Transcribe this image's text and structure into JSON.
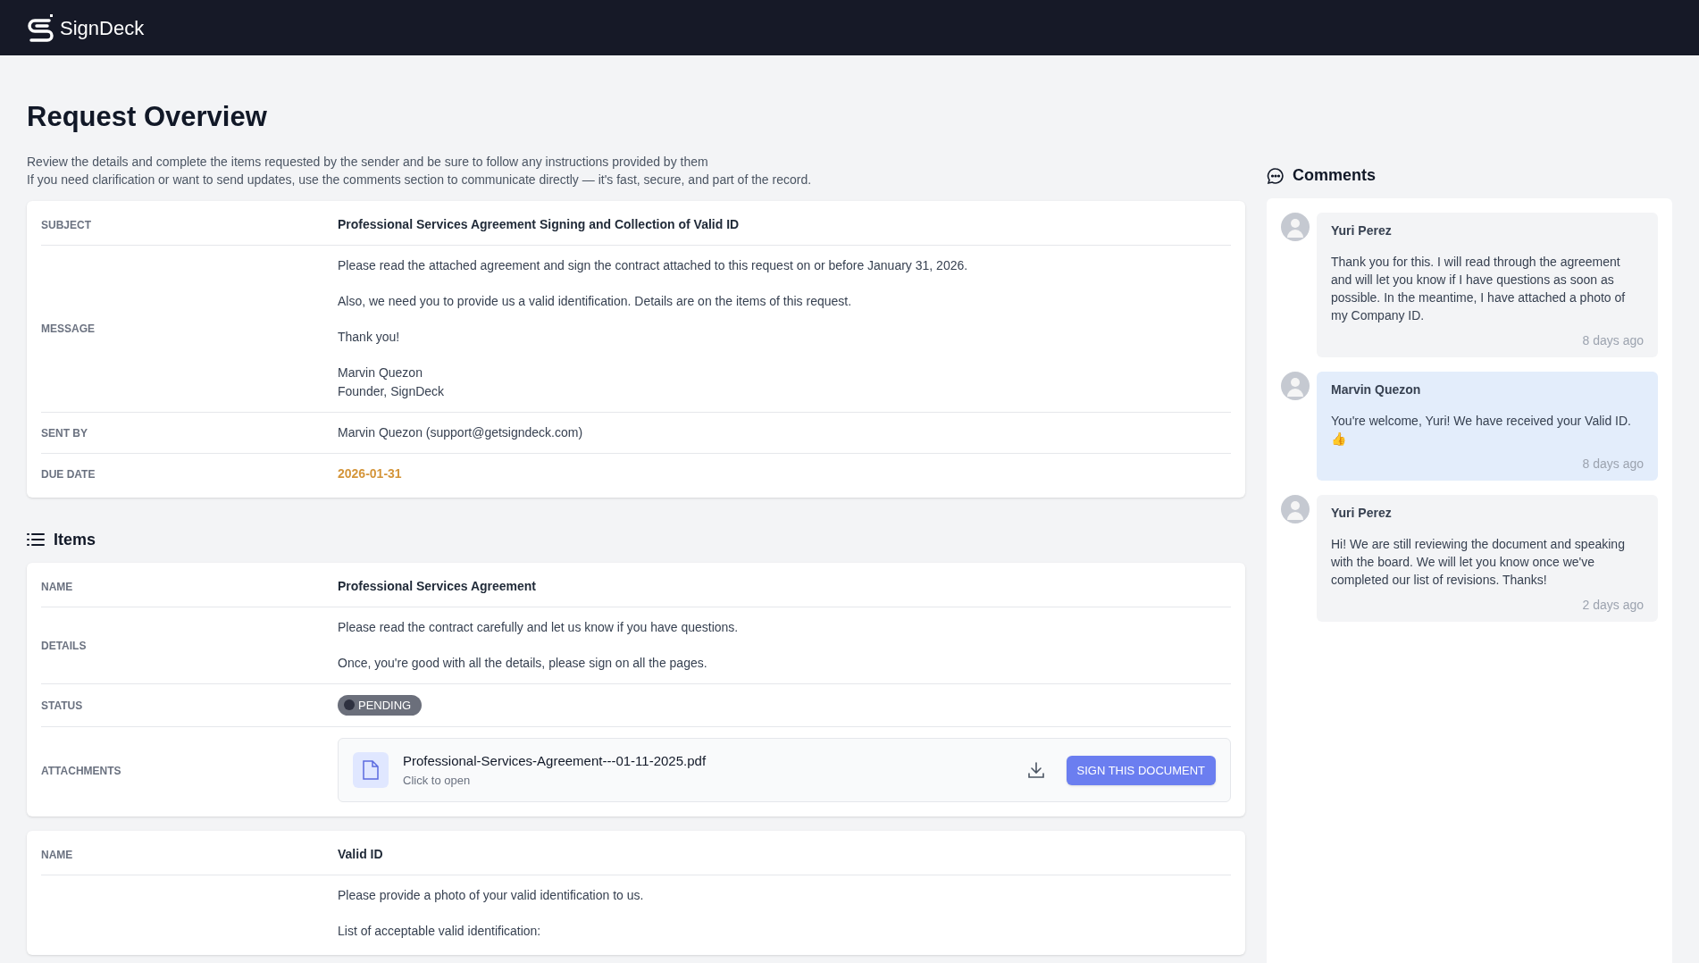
{
  "header": {
    "brand": "SignDeck"
  },
  "page": {
    "title": "Request Overview",
    "intro": [
      "Review the details and complete the items requested by the sender and be sure to follow any instructions provided by them",
      "If you need clarification or want to send updates, use the comments section to communicate directly — it's fast, secure, and part of the record."
    ]
  },
  "request": [
    {
      "label": "SUBJECT",
      "kind": "title",
      "value": [
        "Professional Services Agreement Signing and Collection of Valid ID"
      ]
    },
    {
      "label": "MESSAGE",
      "kind": "text",
      "value": [
        "Please read the attached agreement and sign the contract attached to this request on or before January 31, 2026.",
        "Also, we need you to provide us a valid identification. Details are on the items of this request.",
        "Thank you!",
        "Marvin Quezon\nFounder, SignDeck"
      ]
    },
    {
      "label": "SENT BY",
      "kind": "text",
      "value": [
        "Marvin Quezon (support@getsigndeck.com)"
      ]
    },
    {
      "label": "DUE DATE",
      "kind": "date",
      "value": [
        "2026-01-31"
      ]
    }
  ],
  "items_heading": "Items",
  "items": [
    {
      "rows": [
        {
          "label": "NAME",
          "kind": "title",
          "value": [
            "Professional Services Agreement"
          ]
        },
        {
          "label": "DETAILS",
          "kind": "text",
          "value": [
            "Please read the contract carefully and let us know if you have questions.",
            "Once, you're good with all the details, please sign on all the pages."
          ]
        },
        {
          "label": "STATUS",
          "kind": "status",
          "value": [
            "PENDING"
          ]
        },
        {
          "label": "ATTACHMENTS",
          "kind": "attachment",
          "file": "Professional-Services-Agreement---01-11-2025.pdf",
          "hint": "Click to open",
          "action": "SIGN THIS DOCUMENT"
        }
      ]
    },
    {
      "rows": [
        {
          "label": "NAME",
          "kind": "title",
          "value": [
            "Valid ID"
          ]
        },
        {
          "kind": "text",
          "value": [
            "Please provide a photo of your valid identification to us.",
            "List of acceptable valid identification:"
          ]
        }
      ]
    }
  ],
  "comments_heading": "Comments",
  "comments": [
    {
      "author": "Yuri Perez",
      "text": "Thank you for this. I will read through the agreement and will let you know if I have questions as soon as possible. In the meantime, I have attached a photo of my Company ID.",
      "time": "8 days ago",
      "highlighted": false
    },
    {
      "author": "Marvin Quezon",
      "text": "You're welcome, Yuri! We have received your Valid ID. 👍",
      "time": "8 days ago",
      "highlighted": true
    },
    {
      "author": "Yuri Perez",
      "text": "Hi! We are still reviewing the document and speaking with the board. We will let you know once we've completed our list of revisions. Thanks!",
      "time": "2 days ago",
      "highlighted": false
    }
  ]
}
